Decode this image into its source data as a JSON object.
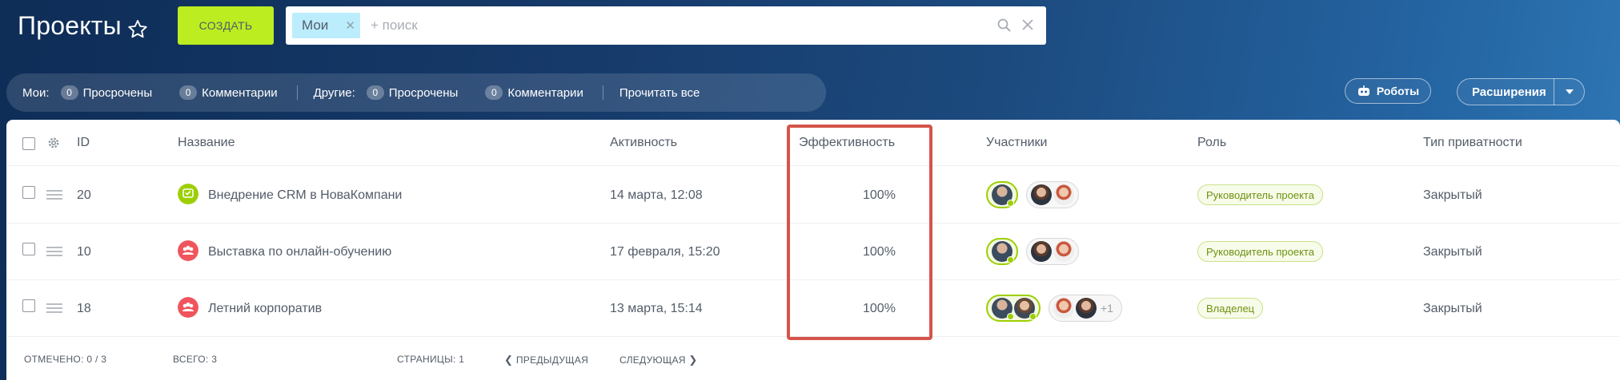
{
  "header": {
    "title": "Проекты",
    "create_label": "СОЗДАТЬ",
    "filter_tag": "Мои",
    "search_placeholder": "+ поиск"
  },
  "counters": {
    "my_label": "Мои:",
    "others_label": "Другие:",
    "my": [
      {
        "count": "0",
        "label": "Просрочены"
      },
      {
        "count": "0",
        "label": "Комментарии"
      }
    ],
    "others": [
      {
        "count": "0",
        "label": "Просрочены"
      },
      {
        "count": "0",
        "label": "Комментарии"
      }
    ],
    "read_all": "Прочитать все"
  },
  "toolbar": {
    "robots_label": "Роботы",
    "extensions_label": "Расширения"
  },
  "columns": {
    "id": "ID",
    "name": "Название",
    "activity": "Активность",
    "efficiency": "Эффективность",
    "participants": "Участники",
    "role": "Роль",
    "privacy": "Тип приватности"
  },
  "rows": [
    {
      "id": "20",
      "name": "Внедрение CRM в НоваКомпани",
      "activity": "14 марта, 12:08",
      "efficiency": "100%",
      "role": "Руководитель проекта",
      "privacy": "Закрытый",
      "icon": "project-chat-icon"
    },
    {
      "id": "10",
      "name": "Выставка по онлайн-обучению",
      "activity": "17 февраля, 15:20",
      "efficiency": "100%",
      "role": "Руководитель проекта",
      "privacy": "Закрытый",
      "icon": "group-icon"
    },
    {
      "id": "18",
      "name": "Летний корпоратив",
      "activity": "13 марта, 15:14",
      "efficiency": "100%",
      "role": "Владелец",
      "privacy": "Закрытый",
      "icon": "group-icon",
      "extra_members": "+1"
    }
  ],
  "footer": {
    "selected": "ОТМЕЧЕНО: 0 / 3",
    "total": "ВСЕГО: 3",
    "pages": "СТРАНИЦЫ: 1",
    "prev": "ПРЕДЫДУЩАЯ",
    "next": "СЛЕДУЮЩАЯ"
  },
  "colors": {
    "create_button": "#bbed21",
    "highlight": "#d4544b",
    "role_badge": "#6e9212"
  }
}
